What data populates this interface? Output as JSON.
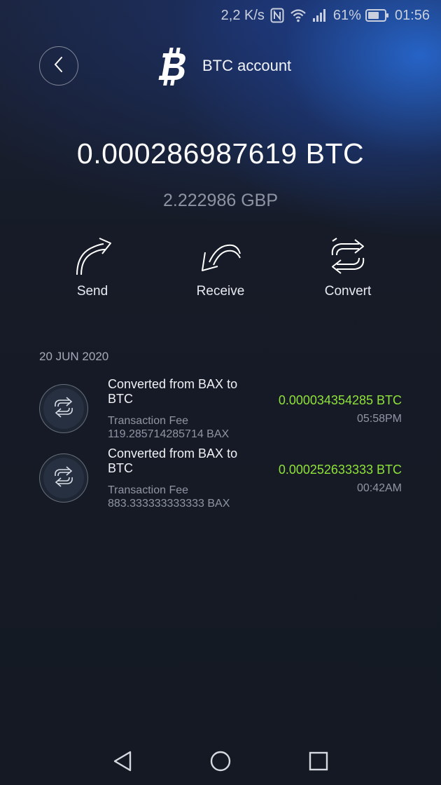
{
  "status_bar": {
    "speed": "2,2 K/s",
    "battery_percent": "61%",
    "time": "01:56",
    "icons": [
      "nfc-icon",
      "wifi-icon",
      "signal-icon",
      "battery-icon"
    ]
  },
  "header": {
    "title": "BTC account",
    "back_icon": "chevron-left-icon",
    "logo_icon": "bitcoin-icon"
  },
  "balance": {
    "crypto": "0.000286987619 BTC",
    "fiat": "2.222986 GBP"
  },
  "actions": [
    {
      "label": "Send",
      "icon": "send-arrow-icon"
    },
    {
      "label": "Receive",
      "icon": "receive-arrow-icon"
    },
    {
      "label": "Convert",
      "icon": "convert-icon"
    }
  ],
  "transactions": {
    "date": "20 JUN 2020",
    "items": [
      {
        "title": "Converted from BAX to BTC",
        "fee_label": "Transaction Fee",
        "fee_value": "119.285714285714 BAX",
        "amount": "0.000034354285 BTC",
        "time": "05:58PM"
      },
      {
        "title": "Converted from BAX to BTC",
        "fee_label": "Transaction Fee",
        "fee_value": "883.333333333333 BAX",
        "amount": "0.000252633333 BTC",
        "time": "00:42AM"
      }
    ]
  },
  "colors": {
    "positive_amount": "#8fe23a",
    "background": "#141923",
    "accent_blue": "#2a6fd6"
  },
  "nav_bar": [
    "nav-back-icon",
    "nav-home-icon",
    "nav-recent-icon"
  ]
}
